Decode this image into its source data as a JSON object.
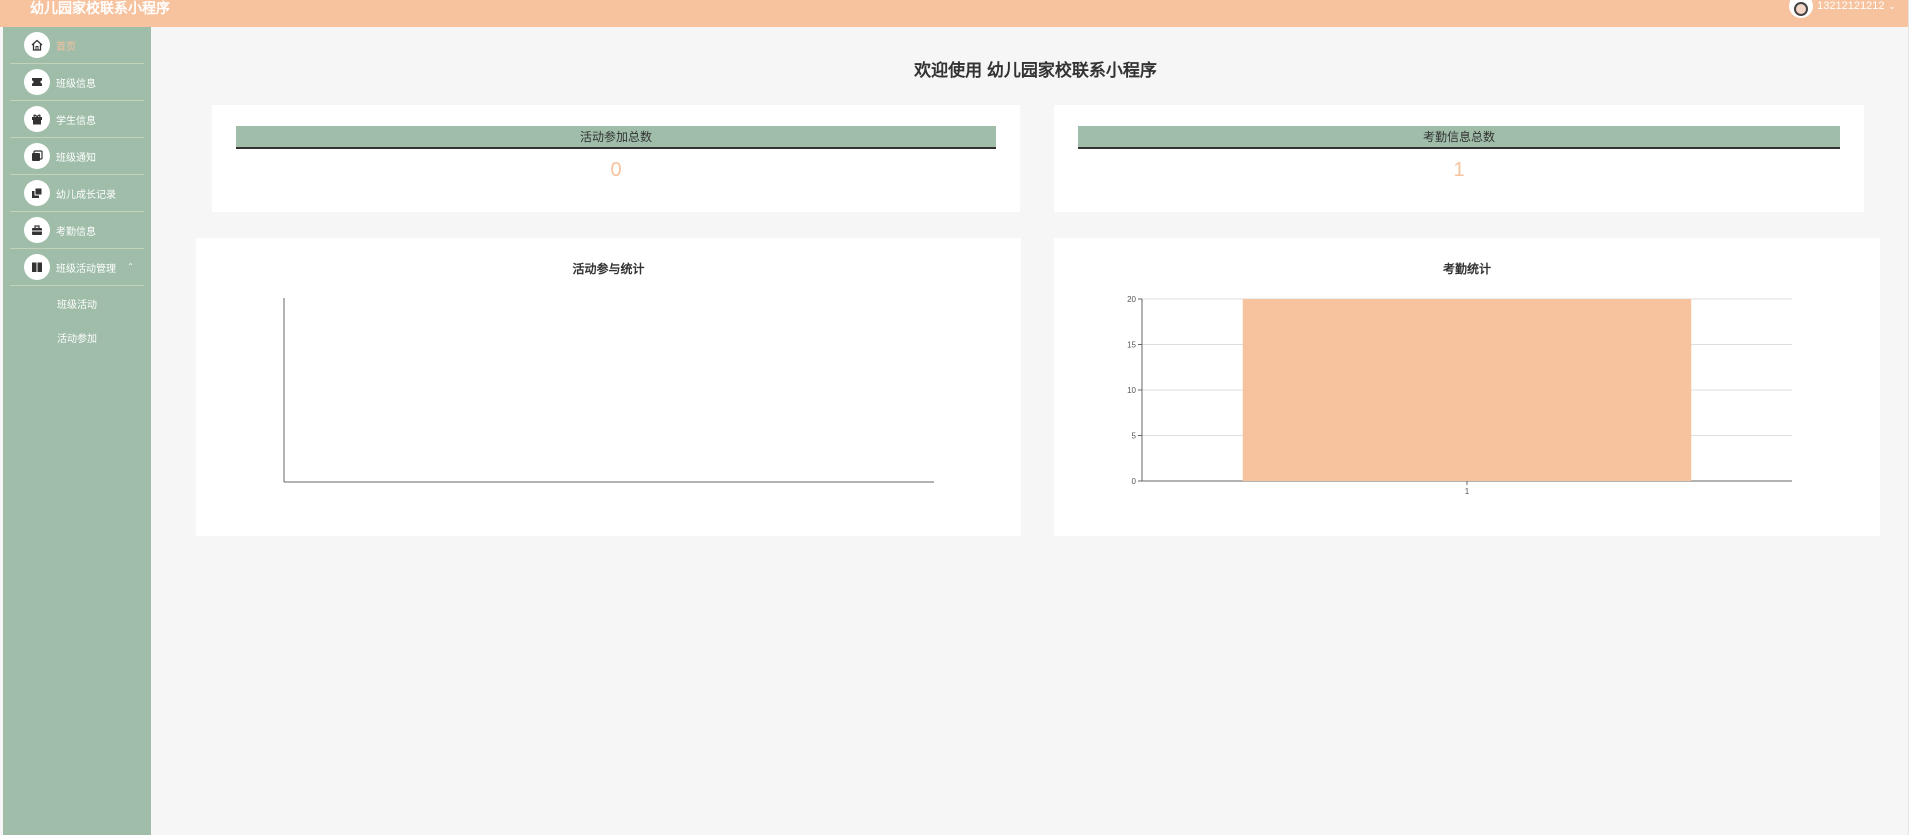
{
  "header": {
    "app_title": "幼儿园家校联系小程序",
    "username": "13212121212",
    "dropdown_icon": "chevron-down-icon"
  },
  "sidebar": {
    "items": [
      {
        "label": "首页",
        "icon": "home-icon",
        "active": true
      },
      {
        "label": "班级信息",
        "icon": "ticket-icon"
      },
      {
        "label": "学生信息",
        "icon": "gift-icon"
      },
      {
        "label": "班级通知",
        "icon": "layers-icon"
      },
      {
        "label": "幼儿成长记录",
        "icon": "copy-icon"
      },
      {
        "label": "考勤信息",
        "icon": "briefcase-icon"
      },
      {
        "label": "班级活动管理",
        "icon": "book-icon",
        "expanded": true
      }
    ],
    "submenu": [
      {
        "label": "班级活动"
      },
      {
        "label": "活动参加"
      }
    ]
  },
  "main": {
    "welcome": "欢迎使用 幼儿园家校联系小程序",
    "stats": [
      {
        "label": "活动参加总数",
        "value": "0"
      },
      {
        "label": "考勤信息总数",
        "value": "1"
      }
    ],
    "charts": [
      {
        "title": "活动参与统计"
      },
      {
        "title": "考勤统计"
      }
    ]
  },
  "colors": {
    "accent": "#f7c29e",
    "sidebar": "#9fbda8",
    "background": "#f6f6f6"
  },
  "chart_data": [
    {
      "type": "bar",
      "title": "活动参与统计",
      "categories": [],
      "values": []
    },
    {
      "type": "bar",
      "title": "考勤统计",
      "categories": [
        "1"
      ],
      "values": [
        20
      ],
      "ylim": [
        0,
        20
      ],
      "yticks": [
        0,
        5,
        10,
        15,
        20
      ],
      "grid": true
    }
  ]
}
